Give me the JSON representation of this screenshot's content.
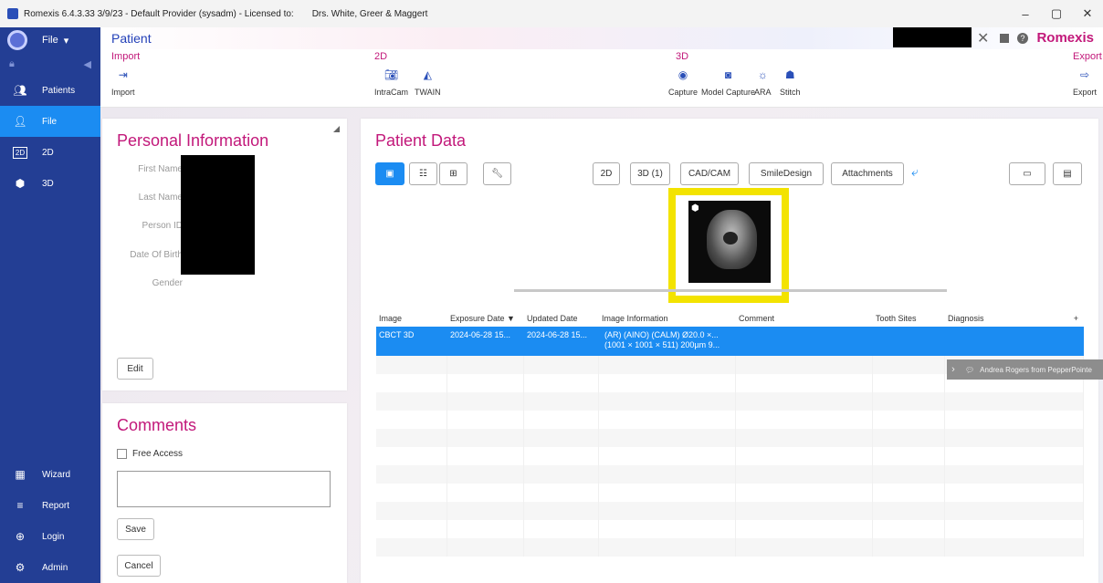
{
  "window": {
    "title": "Romexis 6.4.3.33 3/9/23 - Default Provider (sysadm) - Licensed to:",
    "licensee": "Drs. White, Greer & Maggert",
    "minimize": "–",
    "maximize": "▢",
    "close": "✕"
  },
  "sidebar": {
    "file_menu": "File",
    "items": [
      {
        "label": "Patients",
        "icon": "people-icon"
      },
      {
        "label": "File",
        "icon": "person-icon"
      },
      {
        "label": "2D",
        "icon": "2d-icon"
      },
      {
        "label": "3D",
        "icon": "cube-icon"
      }
    ],
    "bottom_items": [
      {
        "label": "Wizard",
        "icon": "wizard-icon"
      },
      {
        "label": "Report",
        "icon": "report-icon"
      },
      {
        "label": "Login",
        "icon": "login-icon"
      },
      {
        "label": "Admin",
        "icon": "admin-icon"
      }
    ],
    "icon_glyphs": {
      "2d": "2D"
    }
  },
  "header": {
    "title": "Patient",
    "brand": "Romexis",
    "close": "✕",
    "help": "?"
  },
  "toolbar": {
    "import_group": "Import",
    "import_btn": "Import",
    "group_2d": "2D",
    "intracam": "IntraCam",
    "twain": "TWAIN",
    "group_3d": "3D",
    "capture": "Capture",
    "model_capture": "Model Capture",
    "ara": "ARA",
    "stitch": "Stitch",
    "export_group": "Export",
    "export_btn": "Export"
  },
  "personal": {
    "title": "Personal Information",
    "fields": [
      "First Name",
      "Last Name",
      "Person ID",
      "Date Of Birth",
      "Gender"
    ],
    "edit": "Edit"
  },
  "comments": {
    "title": "Comments",
    "free_access": "Free Access",
    "save": "Save",
    "cancel": "Cancel"
  },
  "patient_data": {
    "title": "Patient Data",
    "filters": [
      "2D",
      "3D (1)",
      "CAD/CAM",
      "SmileDesign",
      "Attachments"
    ],
    "undo_glyph": "⤶",
    "plus": "+"
  },
  "table": {
    "columns": [
      "Image",
      "Exposure Date ▼",
      "Updated Date",
      "Image Information",
      "Comment",
      "Tooth Sites",
      "Diagnosis"
    ],
    "rows": [
      {
        "image": "CBCT 3D",
        "exposure": "2024-06-28 15...",
        "updated": "2024-06-28 15...",
        "info_line1": "(AR) (AINO) (CALM) Ø20.0 ×...",
        "info_line2": "(1001 × 1001 × 511) 200µm 9...",
        "comment": "",
        "tooth_sites": "",
        "diagnosis": ""
      }
    ]
  },
  "toast": {
    "text": "Andrea Rogers from PepperPointe"
  }
}
